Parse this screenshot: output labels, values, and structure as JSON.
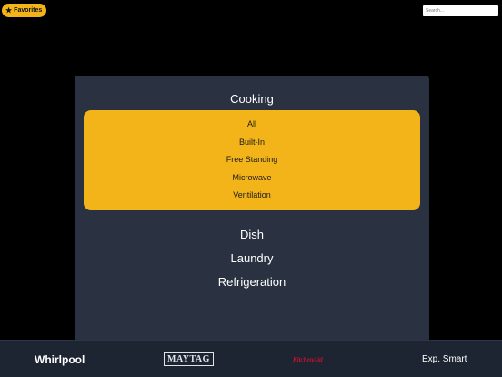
{
  "header": {
    "favorites_label": "Favorites",
    "favorites_icon": "star-icon",
    "search_placeholder": "Search..."
  },
  "menu": {
    "categories": [
      {
        "label": "Cooking",
        "expanded": true,
        "subcategories": [
          "All",
          "Built-In",
          "Free Standing",
          "Microwave",
          "Ventilation"
        ]
      },
      {
        "label": "Dish"
      },
      {
        "label": "Laundry"
      },
      {
        "label": "Refrigeration"
      }
    ]
  },
  "footer": {
    "brands": [
      "Whirlpool",
      "MAYTAG",
      "KitchenAid",
      "Exp. Smart"
    ]
  },
  "colors": {
    "accent": "#f2b418",
    "panel": "#2a3140",
    "footer": "#1d2533",
    "kitchenaid_red": "#c8102e"
  }
}
